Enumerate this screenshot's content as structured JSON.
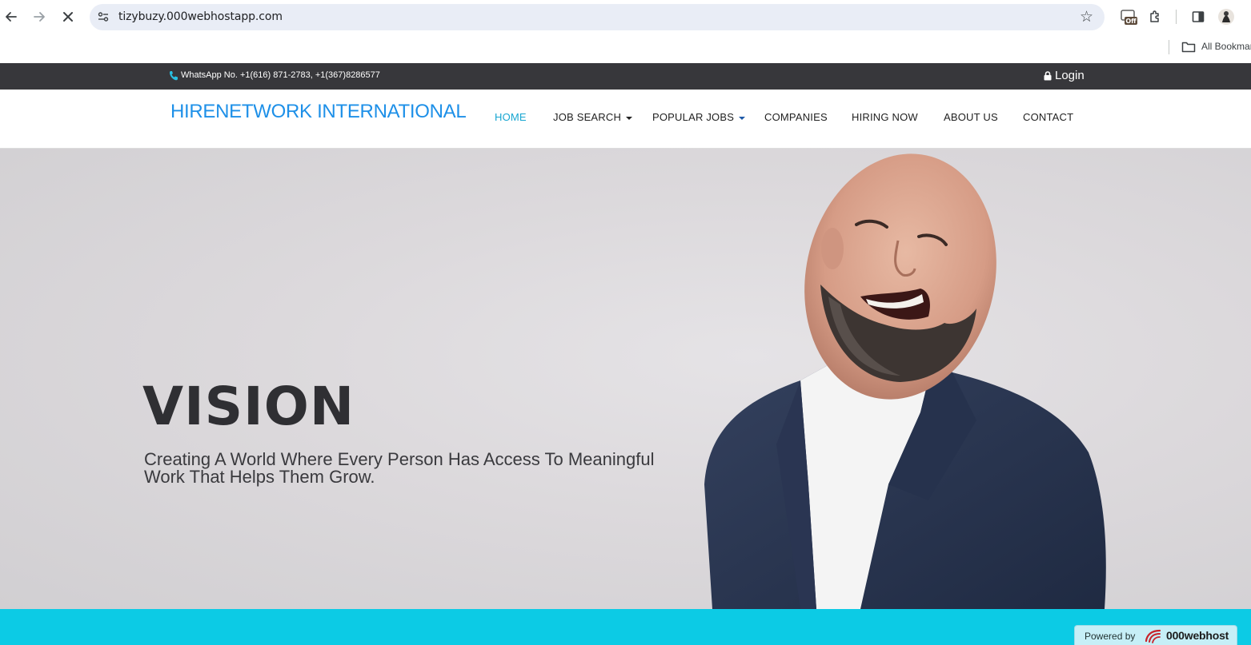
{
  "browser": {
    "url": "tizybuzy.000webhostapp.com",
    "bookmarks_label": "All Bookmar",
    "ext_badge": "Off"
  },
  "topbar": {
    "phone_text": "WhatsApp No. +1(616) 871-2783, +1(367)8286577",
    "login_label": "Login"
  },
  "nav": {
    "brand": "HIRENETWORK INTERNATIONAL",
    "items": [
      {
        "label": "HOME",
        "active": true,
        "dropdown": false
      },
      {
        "label": "JOB SEARCH",
        "active": false,
        "dropdown": true
      },
      {
        "label": "POPULAR JOBS",
        "active": false,
        "dropdown": true
      },
      {
        "label": "COMPANIES",
        "active": false,
        "dropdown": false
      },
      {
        "label": "HIRING NOW",
        "active": false,
        "dropdown": false
      },
      {
        "label": "ABOUT US",
        "active": false,
        "dropdown": false
      },
      {
        "label": "CONTACT",
        "active": false,
        "dropdown": false
      }
    ]
  },
  "hero": {
    "title": "VISION",
    "subtitle_line1": "Creating A World Where Every Person Has Access To Meaningful",
    "subtitle_line2": "Work That Helps Them Grow."
  },
  "footer_badge": {
    "powered_by": "Powered by",
    "brand": "000webhost"
  },
  "colors": {
    "brand_blue": "#1e90e8",
    "active_nav": "#17a6d1",
    "topbar_bg": "#37373b",
    "accent_strip": "#0ccbe5"
  },
  "icons": {
    "back": "arrow-left-icon",
    "forward": "arrow-right-icon",
    "stop": "close-icon",
    "site_info": "tune-icon",
    "bookmark": "star-icon",
    "phone": "phone-icon",
    "login": "lock-icon"
  }
}
